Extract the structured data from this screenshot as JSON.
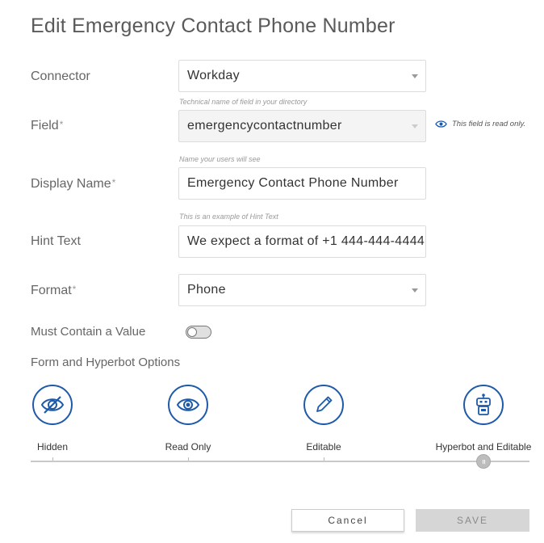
{
  "title": "Edit Emergency Contact Phone Number",
  "connector": {
    "label": "Connector",
    "value": "Workday"
  },
  "field": {
    "label": "Field",
    "required_mark": "*",
    "help": "Technical name of field in your directory",
    "value": "emergencycontactnumber",
    "note": "This field is read only."
  },
  "display_name": {
    "label": "Display Name",
    "required_mark": "*",
    "help": "Name your users will see",
    "value": "Emergency Contact Phone Number"
  },
  "hint_text": {
    "label": "Hint Text",
    "help": "This is an example of Hint Text",
    "value": "We expect a format of +1 444-444-4444"
  },
  "format": {
    "label": "Format",
    "required_mark": "*",
    "value": "Phone"
  },
  "must_contain": {
    "label": "Must Contain a Value",
    "enabled": false
  },
  "options": {
    "heading": "Form and Hyperbot Options",
    "items": [
      {
        "label": "Hidden",
        "icon": "eye-slash-icon"
      },
      {
        "label": "Read Only",
        "icon": "eye-icon"
      },
      {
        "label": "Editable",
        "icon": "pencil-icon"
      },
      {
        "label": "Hyperbot and Editable",
        "icon": "robot-icon"
      }
    ],
    "selected_index": 3
  },
  "buttons": {
    "cancel": "Cancel",
    "save": "SAVE"
  },
  "colors": {
    "accent": "#1e5aa8",
    "save_disabled": "#d6d6d6"
  }
}
